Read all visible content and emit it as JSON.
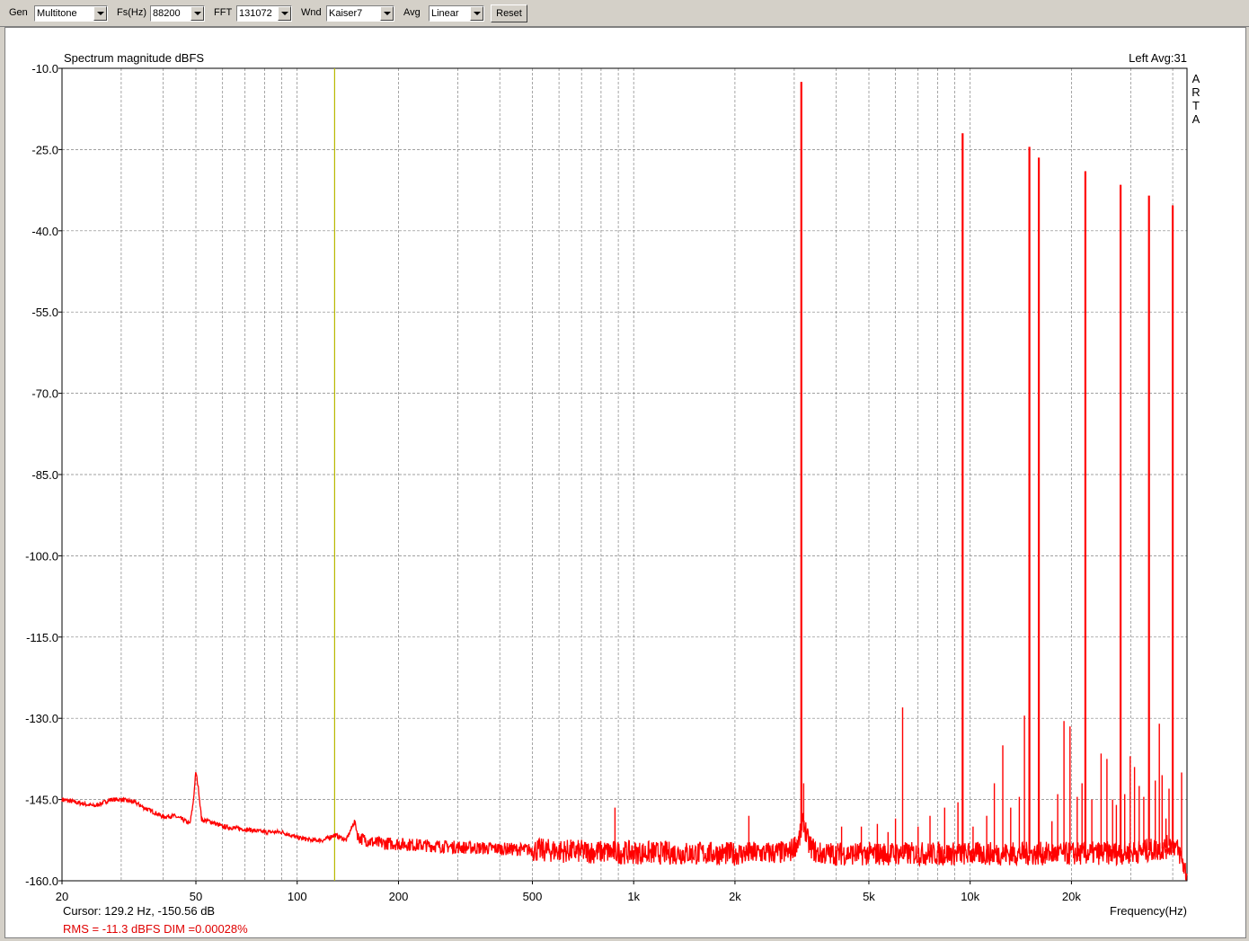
{
  "toolbar": {
    "gen_label": "Gen",
    "gen_value": "Multitone",
    "fs_label": "Fs(Hz)",
    "fs_value": "88200",
    "fft_label": "FFT",
    "fft_value": "131072",
    "wnd_label": "Wnd",
    "wnd_value": "Kaiser7",
    "avg_label": "Avg",
    "avg_value": "Linear",
    "reset_label": "Reset"
  },
  "colors": {
    "trace": "#ff0000",
    "cursor": "#b8b800",
    "grid": "#808080",
    "text_red": "#e00000"
  },
  "chart_data": {
    "type": "line",
    "title": "Spectrum magnitude dBFS",
    "channel_label": "Left  Avg:31",
    "brand": [
      "A",
      "R",
      "T",
      "A"
    ],
    "xlabel": "Frequency(Hz)",
    "x_scale": "log",
    "xlim": [
      20,
      44100
    ],
    "ylim": [
      -160,
      -10
    ],
    "y_ticks": [
      -10.0,
      -25.0,
      -40.0,
      -55.0,
      -70.0,
      -85.0,
      -100.0,
      -115.0,
      -130.0,
      -145.0,
      -160.0
    ],
    "y_tick_labels": [
      "-10.0",
      "-25.0",
      "-40.0",
      "-55.0",
      "-70.0",
      "-85.0",
      "-100.0",
      "-115.0",
      "-130.0",
      "-145.0",
      "-160.0"
    ],
    "x_ticks": [
      20,
      50,
      100,
      200,
      500,
      1000,
      2000,
      5000,
      10000,
      20000
    ],
    "x_tick_labels": [
      "20",
      "50",
      "100",
      "200",
      "500",
      "1k",
      "2k",
      "5k",
      "10k",
      "20k"
    ],
    "grid": true,
    "cursor_freq": 129.2,
    "cursor_text": "Cursor:   129.2 Hz, -150.56 dB",
    "rms_text": "RMS =  -11.3 dBFS   DIM =0.00028%",
    "noise_floor": [
      [
        20,
        -145.0
      ],
      [
        22,
        -145.5
      ],
      [
        25,
        -146.2
      ],
      [
        28,
        -145.0
      ],
      [
        30,
        -145.0
      ],
      [
        33,
        -145.5
      ],
      [
        35,
        -146.5
      ],
      [
        38,
        -147.5
      ],
      [
        40,
        -148.2
      ],
      [
        43,
        -148.0
      ],
      [
        46,
        -148.8
      ],
      [
        48,
        -149.5
      ],
      [
        49,
        -146.0
      ],
      [
        50,
        -139.8
      ],
      [
        51,
        -143.5
      ],
      [
        52,
        -148.8
      ],
      [
        55,
        -149.0
      ],
      [
        60,
        -150.0
      ],
      [
        70,
        -150.5
      ],
      [
        80,
        -151.0
      ],
      [
        90,
        -151.0
      ],
      [
        100,
        -152.0
      ],
      [
        110,
        -152.5
      ],
      [
        120,
        -152.5
      ],
      [
        129,
        -151.5
      ],
      [
        140,
        -152.5
      ],
      [
        148,
        -149.0
      ],
      [
        152,
        -152.0
      ],
      [
        170,
        -153.0
      ],
      [
        200,
        -153.2
      ],
      [
        300,
        -153.8
      ],
      [
        500,
        -154.3
      ],
      [
        700,
        -154.6
      ],
      [
        1000,
        -154.8
      ],
      [
        2000,
        -155.0
      ],
      [
        2900,
        -154.8
      ],
      [
        3100,
        -152.5
      ],
      [
        3200,
        -149.0
      ],
      [
        3300,
        -153.0
      ],
      [
        3500,
        -155.0
      ],
      [
        5000,
        -155.0
      ],
      [
        10000,
        -155.0
      ],
      [
        20000,
        -155.0
      ],
      [
        30000,
        -154.8
      ],
      [
        38000,
        -154.0
      ],
      [
        40000,
        -153.0
      ],
      [
        42000,
        -155.0
      ],
      [
        43000,
        -157.0
      ],
      [
        44100,
        -159.0
      ]
    ],
    "tones": [
      {
        "freq": 3150,
        "db": -12.5
      },
      {
        "freq": 9500,
        "db": -22.0
      },
      {
        "freq": 15000,
        "db": -24.5
      },
      {
        "freq": 16000,
        "db": -26.5
      },
      {
        "freq": 22000,
        "db": -29.0
      },
      {
        "freq": 28000,
        "db": -31.5
      },
      {
        "freq": 34000,
        "db": -33.5
      },
      {
        "freq": 40000,
        "db": -35.3
      }
    ],
    "spurs": [
      {
        "freq": 880,
        "db": -146.5
      },
      {
        "freq": 2200,
        "db": -148.0
      },
      {
        "freq": 3200,
        "db": -142.0
      },
      {
        "freq": 4150,
        "db": -150.0
      },
      {
        "freq": 4750,
        "db": -150.0
      },
      {
        "freq": 5300,
        "db": -149.5
      },
      {
        "freq": 5700,
        "db": -151.0
      },
      {
        "freq": 6000,
        "db": -148.5
      },
      {
        "freq": 6300,
        "db": -128.0
      },
      {
        "freq": 7000,
        "db": -150.0
      },
      {
        "freq": 7600,
        "db": -148.0
      },
      {
        "freq": 8400,
        "db": -146.5
      },
      {
        "freq": 9200,
        "db": -145.5
      },
      {
        "freq": 10200,
        "db": -150.0
      },
      {
        "freq": 11200,
        "db": -148.0
      },
      {
        "freq": 11800,
        "db": -142.0
      },
      {
        "freq": 12500,
        "db": -135.0
      },
      {
        "freq": 13200,
        "db": -146.5
      },
      {
        "freq": 14000,
        "db": -144.5
      },
      {
        "freq": 14500,
        "db": -129.5
      },
      {
        "freq": 17500,
        "db": -149.0
      },
      {
        "freq": 18200,
        "db": -144.0
      },
      {
        "freq": 19000,
        "db": -130.5
      },
      {
        "freq": 19800,
        "db": -131.5
      },
      {
        "freq": 20800,
        "db": -144.5
      },
      {
        "freq": 21500,
        "db": -142.0
      },
      {
        "freq": 23000,
        "db": -145.0
      },
      {
        "freq": 24500,
        "db": -136.5
      },
      {
        "freq": 25500,
        "db": -137.5
      },
      {
        "freq": 26500,
        "db": -145.0
      },
      {
        "freq": 27200,
        "db": -146.0
      },
      {
        "freq": 28800,
        "db": -144.0
      },
      {
        "freq": 29900,
        "db": -137.0
      },
      {
        "freq": 30800,
        "db": -139.0
      },
      {
        "freq": 31800,
        "db": -142.5
      },
      {
        "freq": 32800,
        "db": -144.5
      },
      {
        "freq": 35500,
        "db": -141.5
      },
      {
        "freq": 36500,
        "db": -131.0
      },
      {
        "freq": 37200,
        "db": -140.5
      },
      {
        "freq": 38200,
        "db": -148.5
      },
      {
        "freq": 39000,
        "db": -143.0
      },
      {
        "freq": 42500,
        "db": -140.0
      }
    ]
  }
}
